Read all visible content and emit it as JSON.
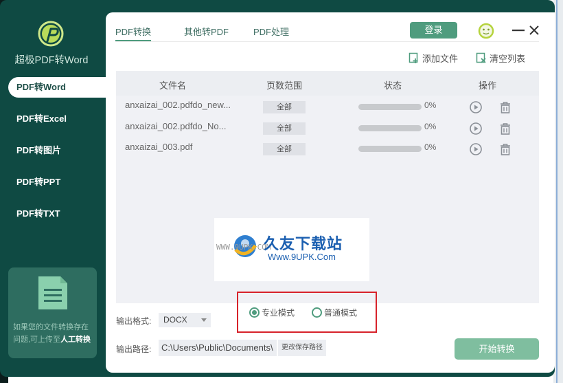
{
  "app": {
    "title": "超极PDF转Word"
  },
  "sidebar": {
    "items": [
      {
        "label": "PDF转Word"
      },
      {
        "label": "PDF转Excel"
      },
      {
        "label": "PDF转图片"
      },
      {
        "label": "PDF转PPT"
      },
      {
        "label": "PDF转TXT"
      }
    ],
    "active_index": 0,
    "help": {
      "text": "如果您的文件转换存在问题,可上传至",
      "strong": "人工转换"
    }
  },
  "tabs": [
    {
      "label": "PDF转换"
    },
    {
      "label": "其他转PDF"
    },
    {
      "label": "PDF处理"
    }
  ],
  "header": {
    "login_label": "登录"
  },
  "toolbar": {
    "add_files": "添加文件",
    "clear_list": "清空列表"
  },
  "table": {
    "columns": [
      "文件名",
      "页数范围",
      "状态",
      "操作"
    ],
    "rows": [
      {
        "filename": "anxaizai_002.pdfdo_new...",
        "pages": "全部",
        "progress": 0,
        "status": "0%"
      },
      {
        "filename": "anxaizai_002.pdfdo_No...",
        "pages": "全部",
        "progress": 0,
        "status": "0%"
      },
      {
        "filename": "anxaizai_003.pdf",
        "pages": "全部",
        "progress": 0,
        "status": "0%"
      }
    ]
  },
  "watermark": {
    "small": "WWW.9UPK.COM",
    "big": "久友下载站",
    "url": "Www.9UPK.Com"
  },
  "output": {
    "format_label": "输出格式:",
    "format_value": "DOCX",
    "path_label": "输出路径:",
    "path_value": "C:\\Users\\Public\\Documents\\",
    "change_path": "更改保存路径"
  },
  "modes": {
    "pro": "专业模式",
    "normal": "普通模式",
    "selected": "pro"
  },
  "start_label": "开始转换",
  "colors": {
    "sidebar": "#0f4a43",
    "accent": "#4f9c7e",
    "start_button": "#7fbe9f",
    "highlight_box": "#d7222a"
  }
}
